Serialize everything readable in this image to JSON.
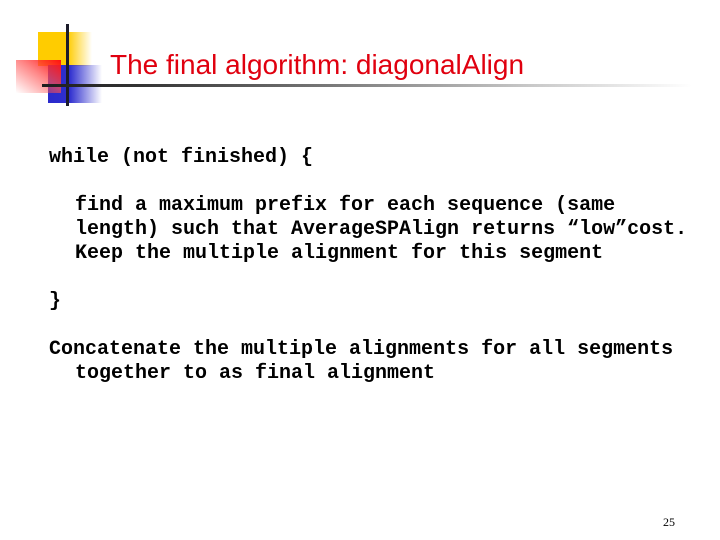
{
  "slide": {
    "title": "The final algorithm: diagonalAlign",
    "title_color": "#e0000f",
    "code": {
      "while_line": "while (not finished) {",
      "body_lines": [
        "find a maximum prefix for each sequence (same",
        "length) such that AverageSPAlign returns “low”cost.",
        "Keep the multiple alignment for this segment"
      ],
      "close_brace": "}",
      "concat_lines": [
        "Concatenate the multiple alignments for all segments",
        "together to as final alignment"
      ]
    },
    "page_number": "25",
    "decoration": {
      "icon": "slide-corner-ornament-icon",
      "colors": {
        "yellow": "#ffcc00",
        "red": "#ff1010",
        "blue": "#2a2acc",
        "line": "#1c1c2a"
      }
    }
  }
}
